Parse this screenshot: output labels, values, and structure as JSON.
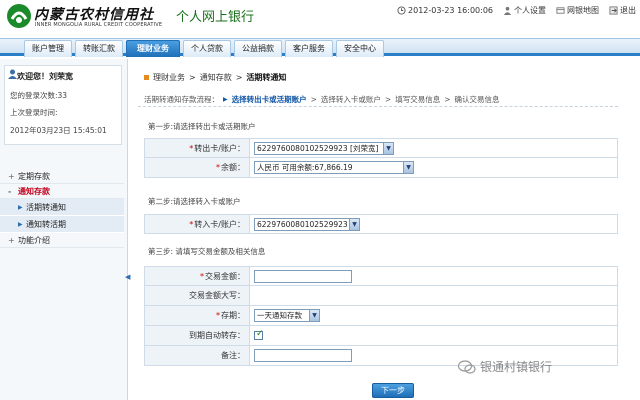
{
  "header": {
    "logo_cn": "内蒙古农村信用社",
    "logo_en": "INNER MONGOLIA RURAL CREDIT COOPERATIVE",
    "bank_title": "个人网上银行",
    "datetime": "2012-03-23 16:00:06",
    "links": {
      "settings": "个人设置",
      "sitemap": "网银地图",
      "logout": "退出"
    },
    "brand_green": "#1a6f1a",
    "brand_red": "#c0001c"
  },
  "nav": {
    "items": [
      "账户管理",
      "转账汇款",
      "理财业务",
      "个人贷款",
      "公益捐款",
      "客户服务",
      "安全中心"
    ],
    "active_index": 2,
    "accent": "#2a7fc8"
  },
  "sidebar": {
    "welcome": "欢迎您！刘荣宽",
    "login_count": "您的登录次数:33",
    "last_login_label": "上次登录时间:",
    "last_login_time": "2012年03月23日  15:45:01",
    "menu": {
      "fixed_deposit": "定期存款",
      "notice_deposit": "通知存款",
      "sub_current_to_notice": "活期转通知",
      "sub_notice_to_current": "通知转活期",
      "intro": "功能介绍"
    }
  },
  "main": {
    "breadcrumb": [
      "理财业务",
      "通知存款",
      "活期转通知"
    ],
    "flow_label": "活期转通知存款流程：",
    "flow_steps": [
      "选择转出卡或活期账户",
      "选择转入卡或账户",
      "填写交易信息",
      "确认交易信息"
    ],
    "step1_title": "第一步:请选择转出卡或活期账户",
    "step2_title": "第二步:请选择转入卡或账户",
    "step3_title": "第三步: 请填写交易金额及相关信息",
    "fields": {
      "out_card_label": "转出卡/账户：",
      "out_card_value": "6229760080102529923 [刘荣宽]",
      "balance_label": "余额：",
      "balance_value": "人民币 可用余额:67,866.19",
      "in_card_label": "转入卡/账户：",
      "in_card_value": "6229760080102529923",
      "amount_label": "交易金额：",
      "amount_value": "",
      "amount_upper_label": "交易金额大写：",
      "term_label": "存期：",
      "term_value": "一天通知存款",
      "auto_renew_label": "到期自动转存：",
      "auto_renew_checked": true,
      "remark_label": "备注：",
      "remark_value": ""
    },
    "next_button": "下一步"
  },
  "watermark": "银通村镇银行"
}
